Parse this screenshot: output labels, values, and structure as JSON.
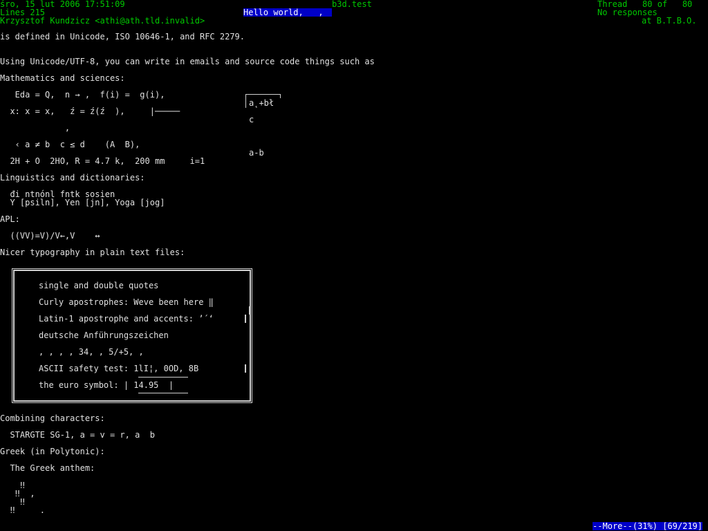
{
  "header": {
    "date": "śro, 15 lut 2006 17:51:09",
    "subject": "b3d.test",
    "thread": "Thread   80 of   80",
    "lines": "Lines 215",
    "title_highlight": "Hello world,   ,",
    "responses": "No responses",
    "author": "Krzysztof Kundzicz <athi@ath.tld.invalid>",
    "location": "at B.T.B.O."
  },
  "body": {
    "l1": "is defined in Unicode, ISO 10646-1, and RFC 2279.",
    "l2": "Using Unicode/UTF-8, you can write in emails and source code things such as",
    "l3": "Mathematics and sciences:",
    "m1": "   Eda = Q,  n → ,  f(i) =  g(i),",
    "m2": "  x: x = x,   ź = ź(ź  ),     |─────",
    "m3": "             ,",
    "m4": "   ‹ a ≠ b  c ≤ d    (A  B),",
    "m5": "  2H + O  2HO, R = 4.7 k,  200 mm     i=1",
    "frac_num": "a˛+bł",
    "frac_c": "c",
    "frac_ab": "a-b",
    "l4": "Linguistics and dictionaries:",
    "ling1": "  đi ntnónl fntk sosien",
    "ling2": "  Y [psiln], Yen [jn], Yoga [jog]",
    "l5": "APL:",
    "apl": "  ((VV)=V)/V←,V    ↔",
    "l6": "Nicer typography in plain text files:",
    "box": {
      "b1": "single and double quotes",
      "b2": "Curly apostrophes: Weve been here ‖",
      "b3": "Latin-1 apostrophe and accents: ’´‘",
      "b4": "deutsche Anführungszeichen",
      "b5": ", , , , 34, , 5/+5, ,",
      "b6": "ASCII safety test: 1lI¦, 0OD, 8B",
      "b7": "the euro symbol: | 14.95  |"
    },
    "l7": "Combining characters:",
    "comb": "  STARGTE SG-1, a = v = r, a  b",
    "l8": "Greek (in Polytonic):",
    "greek_title": "  The Greek anthem:",
    "g1": "    ‼",
    "g2": "   ‼  ,",
    "g3": "    ‼",
    "g4": "  ‼     ."
  },
  "footer": {
    "more": "--More--(31%) [69/219]"
  }
}
